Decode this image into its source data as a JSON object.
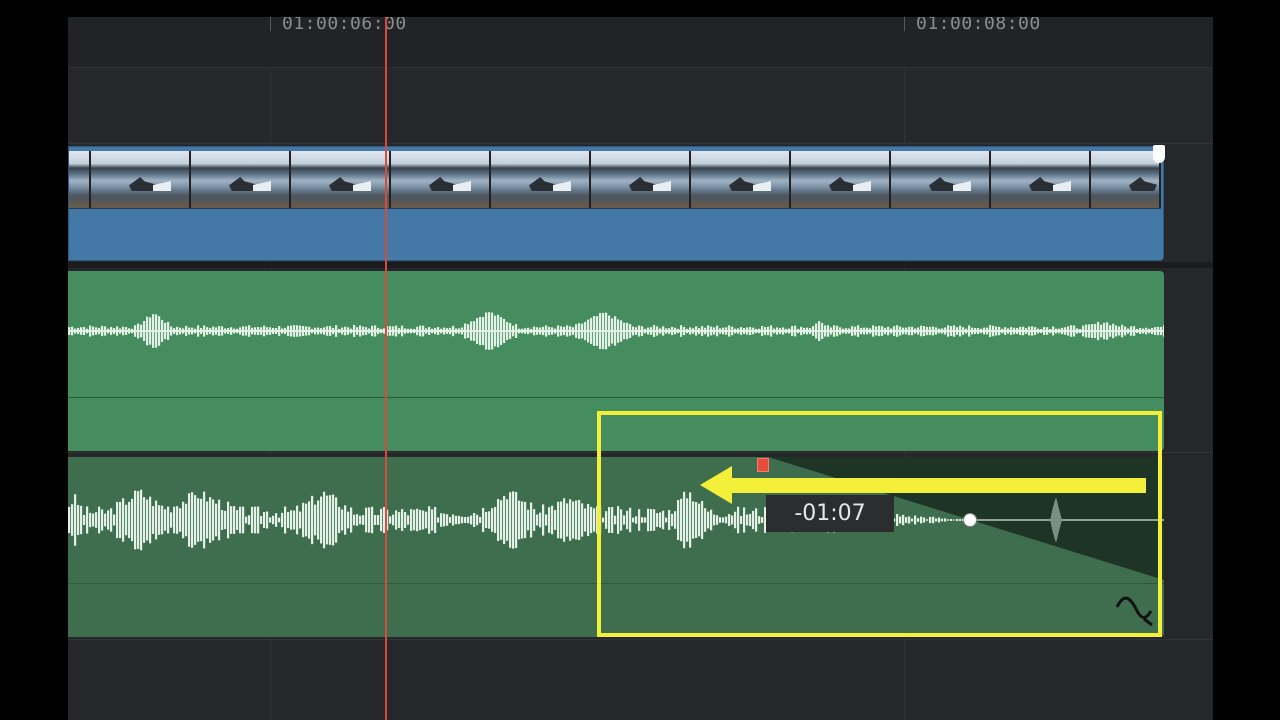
{
  "ruler": {
    "timecodes": [
      "01:00:06:00",
      "01:00:08:00"
    ]
  },
  "tooltip": {
    "duration": "-01:07"
  },
  "colors": {
    "video_clip": "#4478a6",
    "audio_track_1": "#458d5f",
    "audio_track_2": "#3f6e4f",
    "playhead": "#d84a3a",
    "highlight": "#f4f03a"
  },
  "icons": [
    "fade-curve-icon",
    "fade-handle-icon",
    "arrow-icon"
  ]
}
